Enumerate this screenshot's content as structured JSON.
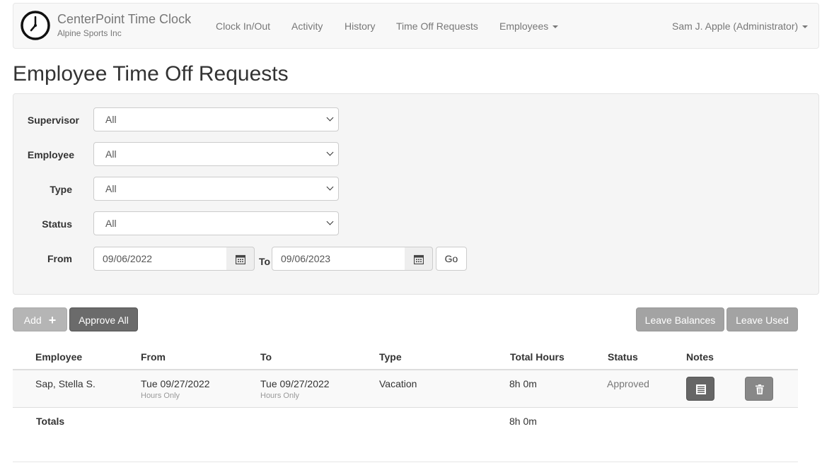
{
  "app": {
    "name": "CenterPoint Time Clock",
    "company": "Alpine Sports Inc"
  },
  "nav": {
    "items": [
      "Clock In/Out",
      "Activity",
      "History",
      "Time Off Requests",
      "Employees"
    ],
    "user": "Sam J. Apple (Administrator)"
  },
  "page": {
    "title": "Employee Time Off Requests"
  },
  "filters": {
    "supervisor_label": "Supervisor",
    "supervisor_value": "All",
    "employee_label": "Employee",
    "employee_value": "All",
    "type_label": "Type",
    "type_value": "All",
    "status_label": "Status",
    "status_value": "All",
    "from_label": "From",
    "from_value": "09/06/2022",
    "to_label": "To",
    "to_value": "09/06/2023",
    "go_label": "Go"
  },
  "actions": {
    "add_label": "Add",
    "approve_all_label": "Approve All",
    "leave_balances_label": "Leave Balances",
    "leave_used_label": "Leave Used"
  },
  "table": {
    "headers": [
      "Employee",
      "From",
      "To",
      "Type",
      "Total Hours",
      "Status",
      "Notes"
    ],
    "rows": [
      {
        "employee": "Sap, Stella S.",
        "from": "Tue 09/27/2022",
        "from_note": "Hours Only",
        "to": "Tue 09/27/2022",
        "to_note": "Hours Only",
        "type": "Vacation",
        "total_hours": "8h 0m",
        "status": "Approved"
      }
    ],
    "totals_label": "Totals",
    "totals_hours": "8h 0m"
  },
  "icons": {
    "logo": "clock-icon",
    "calendar": "calendar-icon",
    "notes": "notes-icon",
    "delete": "trash-icon",
    "add": "plus-icon"
  }
}
